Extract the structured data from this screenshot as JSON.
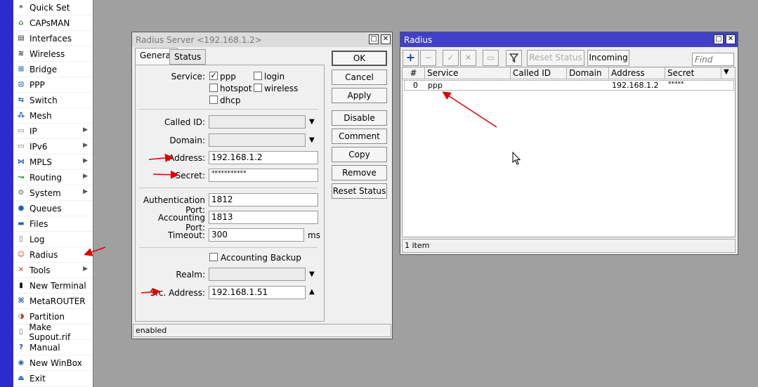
{
  "sidebar": {
    "items": [
      {
        "label": "Quick Set",
        "icon": "wand-icon",
        "submenu": false
      },
      {
        "label": "CAPsMAN",
        "icon": "antenna-icon",
        "submenu": false
      },
      {
        "label": "Interfaces",
        "icon": "interfaces-icon",
        "submenu": false
      },
      {
        "label": "Wireless",
        "icon": "wireless-icon",
        "submenu": false
      },
      {
        "label": "Bridge",
        "icon": "bridge-icon",
        "submenu": false
      },
      {
        "label": "PPP",
        "icon": "ppp-icon",
        "submenu": false
      },
      {
        "label": "Switch",
        "icon": "switch-icon",
        "submenu": false
      },
      {
        "label": "Mesh",
        "icon": "mesh-icon",
        "submenu": false
      },
      {
        "label": "IP",
        "icon": "ip-icon",
        "submenu": true
      },
      {
        "label": "IPv6",
        "icon": "ipv6-icon",
        "submenu": true
      },
      {
        "label": "MPLS",
        "icon": "mpls-icon",
        "submenu": true
      },
      {
        "label": "Routing",
        "icon": "routing-icon",
        "submenu": true
      },
      {
        "label": "System",
        "icon": "gear-icon",
        "submenu": true
      },
      {
        "label": "Queues",
        "icon": "queues-icon",
        "submenu": false
      },
      {
        "label": "Files",
        "icon": "folder-icon",
        "submenu": false
      },
      {
        "label": "Log",
        "icon": "log-icon",
        "submenu": false
      },
      {
        "label": "Radius",
        "icon": "radius-users-icon",
        "submenu": false
      },
      {
        "label": "Tools",
        "icon": "tools-icon",
        "submenu": true
      },
      {
        "label": "New Terminal",
        "icon": "terminal-icon",
        "submenu": false
      },
      {
        "label": "MetaROUTER",
        "icon": "metarouter-icon",
        "submenu": false
      },
      {
        "label": "Partition",
        "icon": "partition-icon",
        "submenu": false
      },
      {
        "label": "Make Supout.rif",
        "icon": "document-icon",
        "submenu": false
      },
      {
        "label": "Manual",
        "icon": "help-icon",
        "submenu": false
      },
      {
        "label": "New WinBox",
        "icon": "winbox-icon",
        "submenu": false
      },
      {
        "label": "Exit",
        "icon": "exit-icon",
        "submenu": false
      }
    ]
  },
  "server_window": {
    "title": "Radius Server <192.168.1.2>",
    "tabs": [
      "General",
      "Status"
    ],
    "service_label": "Service:",
    "services": {
      "ppp": "ppp",
      "login": "login",
      "hotspot": "hotspot",
      "wireless": "wireless",
      "dhcp": "dhcp"
    },
    "service_checked": {
      "ppp": true,
      "login": false,
      "hotspot": false,
      "wireless": false,
      "dhcp": false
    },
    "called_id_label": "Called ID:",
    "called_id": "",
    "domain_label": "Domain:",
    "domain": "",
    "address_label": "Address:",
    "address": "192.168.1.2",
    "secret_label": "Secret:",
    "secret": "***********",
    "auth_port_label": "Authentication Port:",
    "auth_port": "1812",
    "acct_port_label": "Accounting Port:",
    "acct_port": "1813",
    "timeout_label": "Timeout:",
    "timeout": "300",
    "timeout_unit": "ms",
    "acct_backup_label": "Accounting Backup",
    "acct_backup_checked": false,
    "realm_label": "Realm:",
    "realm": "",
    "src_address_label": "Src. Address:",
    "src_address": "192.168.1.51",
    "buttons": {
      "ok": "OK",
      "cancel": "Cancel",
      "apply": "Apply",
      "disable": "Disable",
      "comment": "Comment",
      "copy": "Copy",
      "remove": "Remove",
      "reset_status": "Reset Status"
    },
    "status_text": "enabled"
  },
  "radius_window": {
    "title": "Radius",
    "toolbar": {
      "reset_status": "Reset Status",
      "incoming": "Incoming",
      "find_placeholder": "Find"
    },
    "columns": [
      "#",
      "Service",
      "Called ID",
      "Domain",
      "Address",
      "Secret"
    ],
    "rows": [
      {
        "num": "0",
        "service": "ppp",
        "called_id": "",
        "domain": "",
        "address": "192.168.1.2",
        "secret": "*****"
      }
    ],
    "item_count": "1 item"
  },
  "colors": {
    "accent": "#4040c8",
    "strip": "#2b2bd0",
    "annotation_arrow": "#e00000"
  }
}
